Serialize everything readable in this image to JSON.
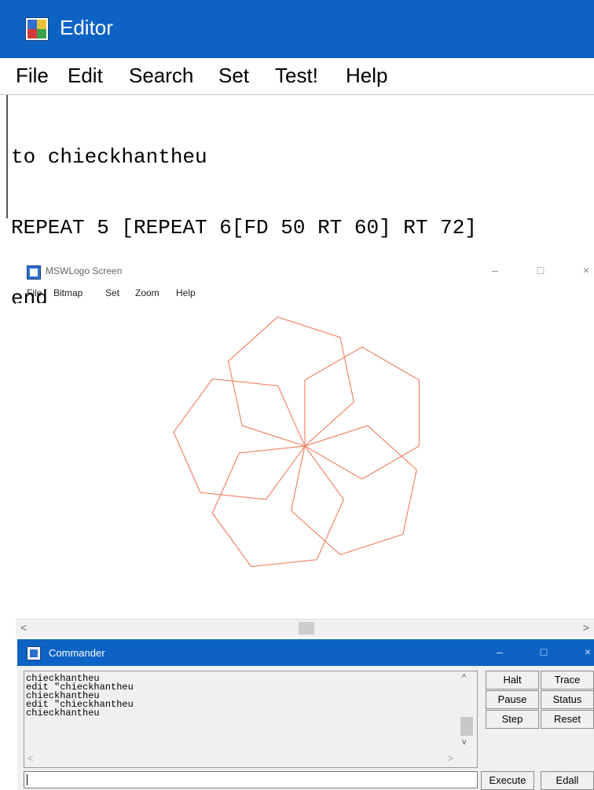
{
  "editor": {
    "title": "Editor",
    "menu": [
      "File",
      "Edit",
      "Search",
      "Set",
      "Test!",
      "Help"
    ],
    "code_lines": [
      "to chieckhantheu",
      "REPEAT 5 [REPEAT 6[FD 50 RT 60] RT 72]",
      "end"
    ]
  },
  "screen": {
    "title": "MSWLogo Screen",
    "menu": [
      "File",
      "Bitmap",
      "Set",
      "Zoom",
      "Help"
    ],
    "window_controls": [
      "–",
      "□",
      "×"
    ],
    "drawing": {
      "outer_repeat": 5,
      "outer_turn_deg": 72,
      "inner_repeat": 6,
      "forward": 50,
      "inner_turn_deg": 60,
      "pen_color": "#f0866a"
    }
  },
  "commander": {
    "title": "Commander",
    "window_controls": [
      "–",
      "□",
      "×"
    ],
    "history": [
      "chieckhantheu",
      "edit \"chieckhantheu",
      "chieckhantheu",
      "edit \"chieckhantheu",
      "chieckhantheu"
    ],
    "input_value": "",
    "buttons": {
      "halt": "Halt",
      "trace": "Trace",
      "pause": "Pause",
      "status": "Status",
      "step": "Step",
      "reset": "Reset",
      "execute": "Execute",
      "edall": "Edall"
    }
  },
  "colors": {
    "titlebar_blue": "#0c63c4",
    "pen": "#f0866a"
  }
}
